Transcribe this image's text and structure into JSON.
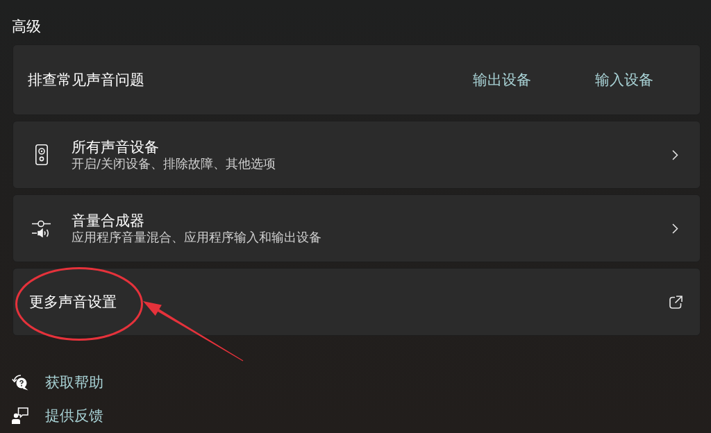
{
  "section_title": "高级",
  "cards": [
    {
      "kind": "links",
      "title": "排查常见声音问题",
      "links": [
        "输出设备",
        "输入设备"
      ],
      "circled": false
    },
    {
      "kind": "nav",
      "title": "所有声音设备",
      "subtitle": "开启/关闭设备、排除故障、其他选项",
      "circled": false
    },
    {
      "kind": "nav",
      "title": "音量合成器",
      "subtitle": "应用程序音量混合、应用程序输入和输出设备",
      "circled": false
    },
    {
      "kind": "external",
      "title": "更多声音设置",
      "circled": true
    }
  ],
  "footer_links": [
    "获取帮助",
    "提供反馈"
  ]
}
